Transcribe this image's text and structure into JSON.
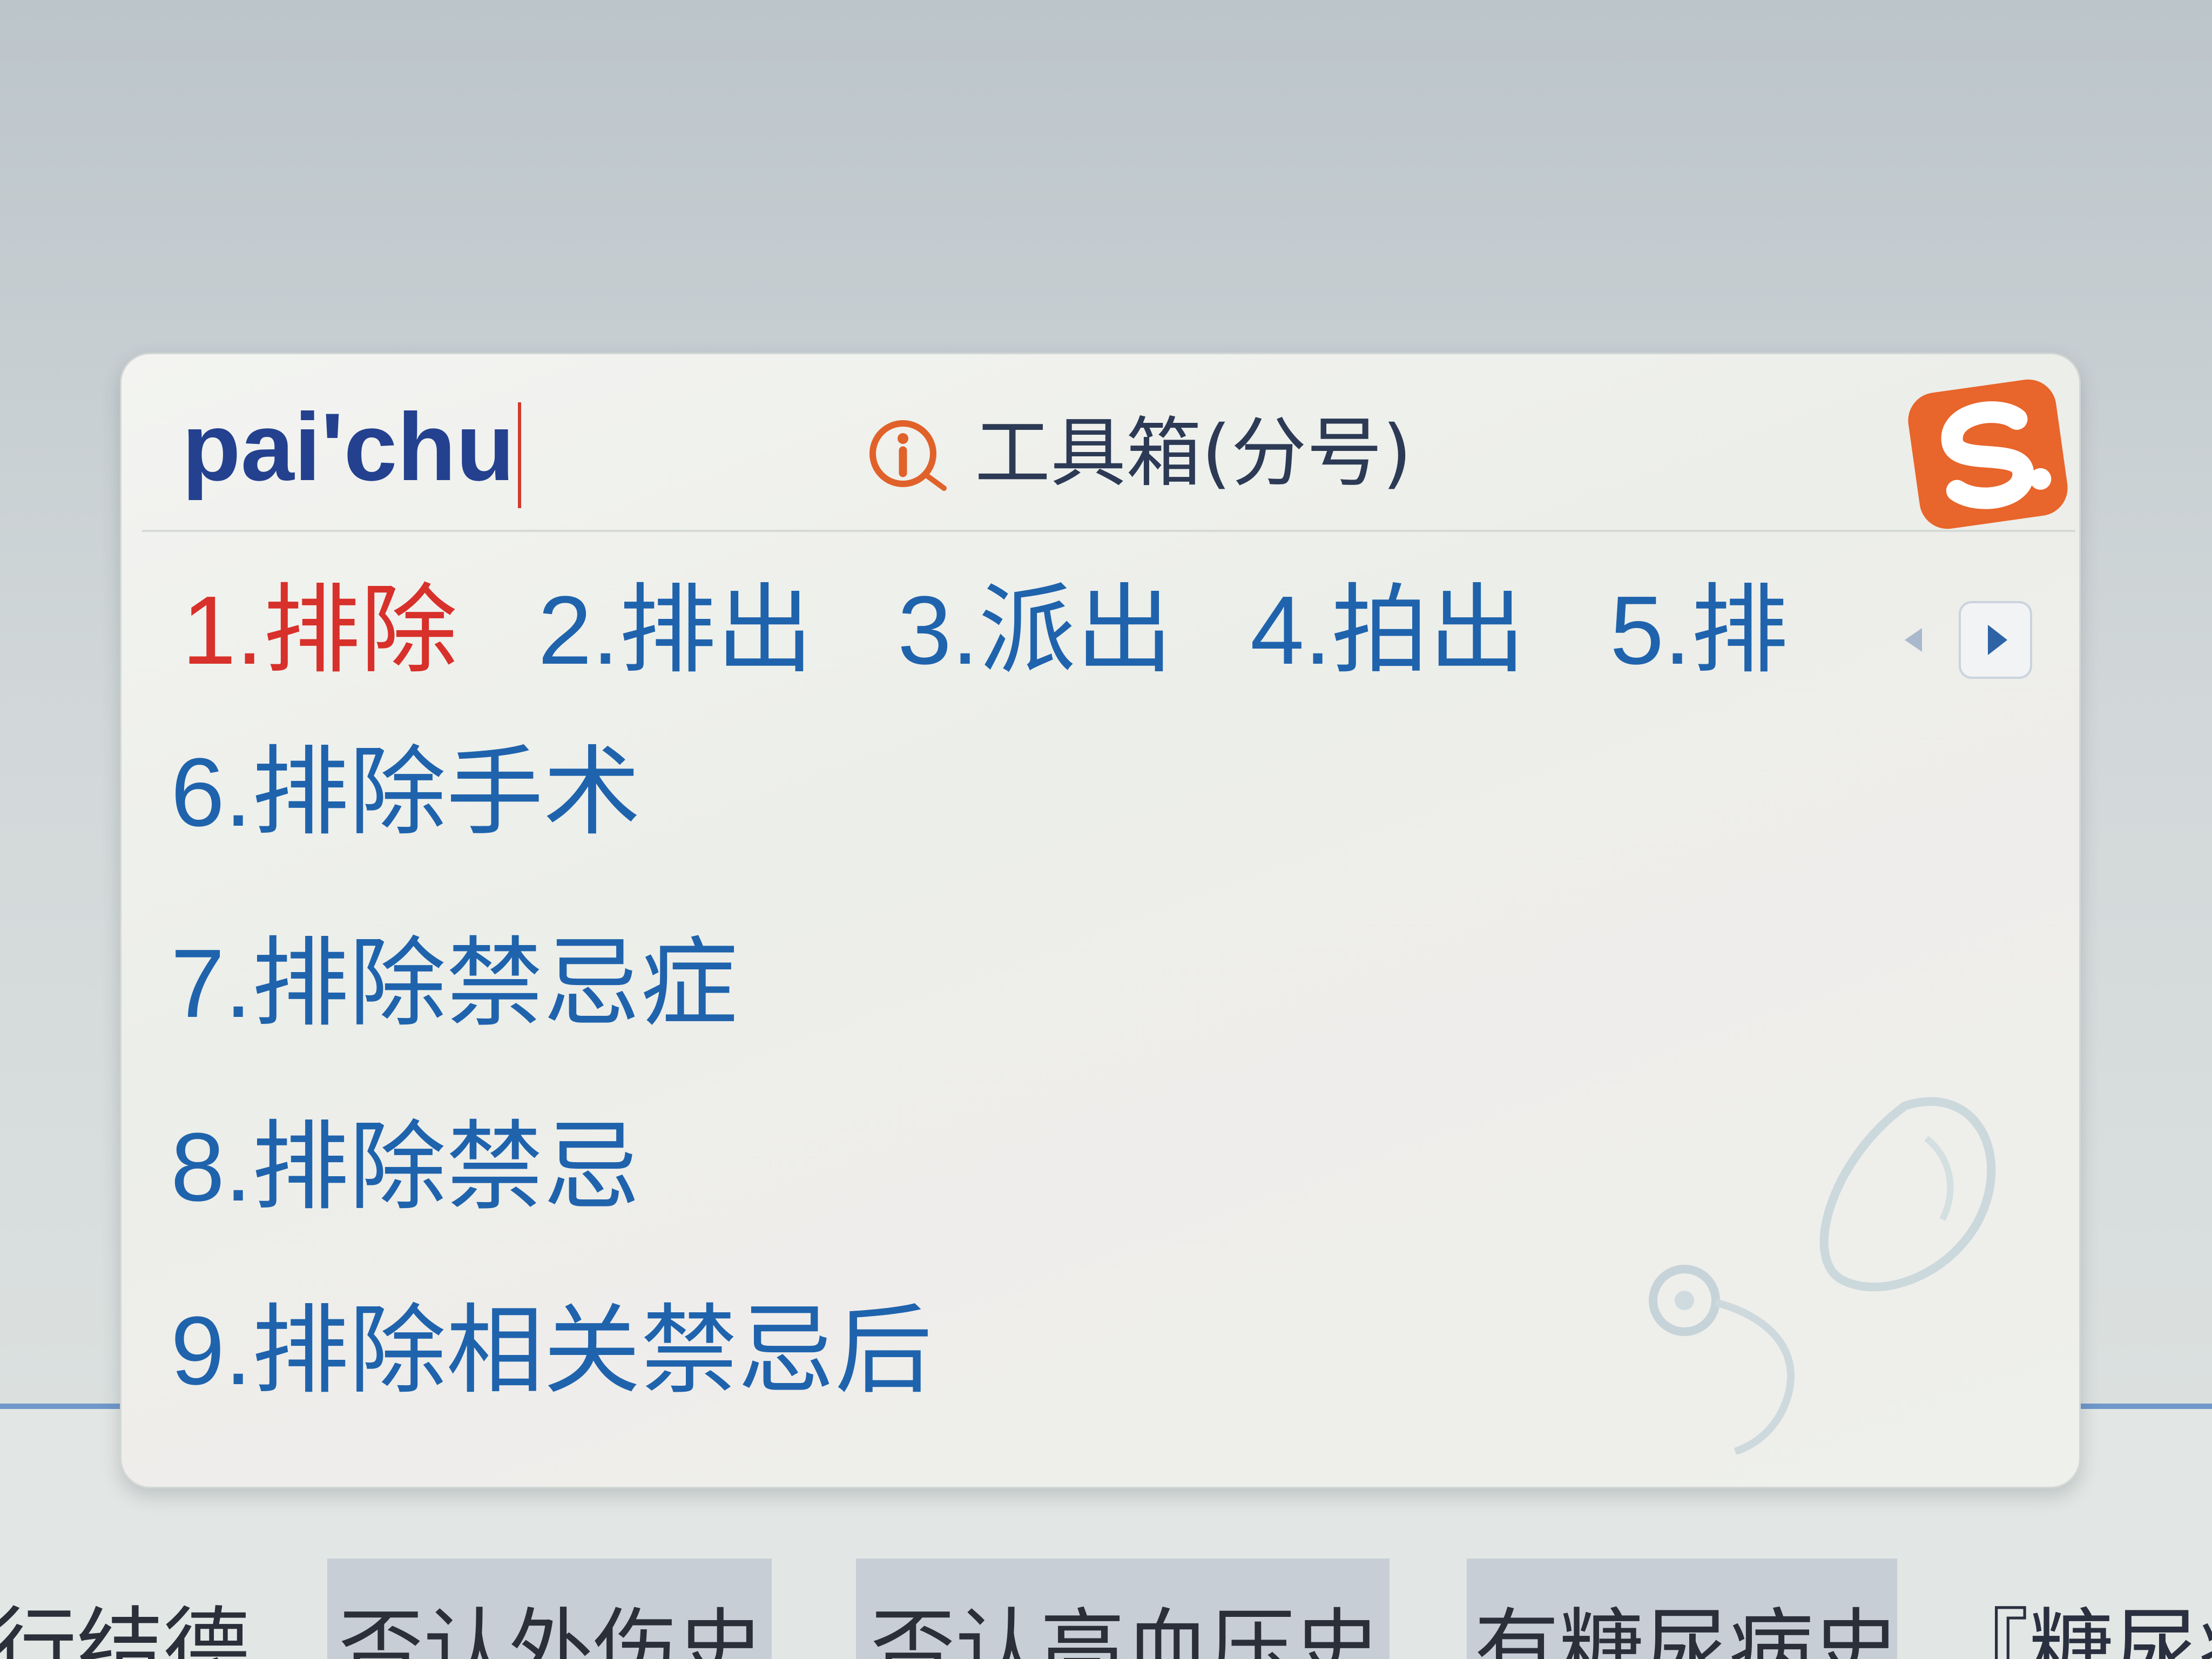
{
  "ime": {
    "composition": "pai'chu",
    "toolbox_label": "工具箱(分号)",
    "icons": {
      "info": "info-icon",
      "logo": "sogou-logo-icon",
      "prev_page": "chevron-left-icon",
      "next_page": "chevron-right-icon",
      "skin": "skin-decoration"
    },
    "candidates_row": [
      {
        "label": "1.排除",
        "selected": true
      },
      {
        "label": "2.排出",
        "selected": false
      },
      {
        "label": "3.派出",
        "selected": false
      },
      {
        "label": "4.拍出",
        "selected": false
      },
      {
        "label": "5.排",
        "selected": false
      }
    ],
    "candidates_more": [
      "6.排除手术",
      "7.排除禁忌症",
      "8.排除禁忌",
      "9.排除相关禁忌后"
    ]
  },
  "page_behind": {
    "partial_text": "行结德",
    "quick_phrases": [
      "否认外伤史",
      "否认高血压史",
      "有糖尿病史",
      "『糖尿病"
    ]
  },
  "colors": {
    "composition_text": "#24418f",
    "selected_candidate": "#d8302a",
    "candidate": "#1f63ad",
    "toolbox_text": "#2c3a55",
    "accent_orange": "#e8652b",
    "page_divider_blue": "#6f98c9"
  }
}
